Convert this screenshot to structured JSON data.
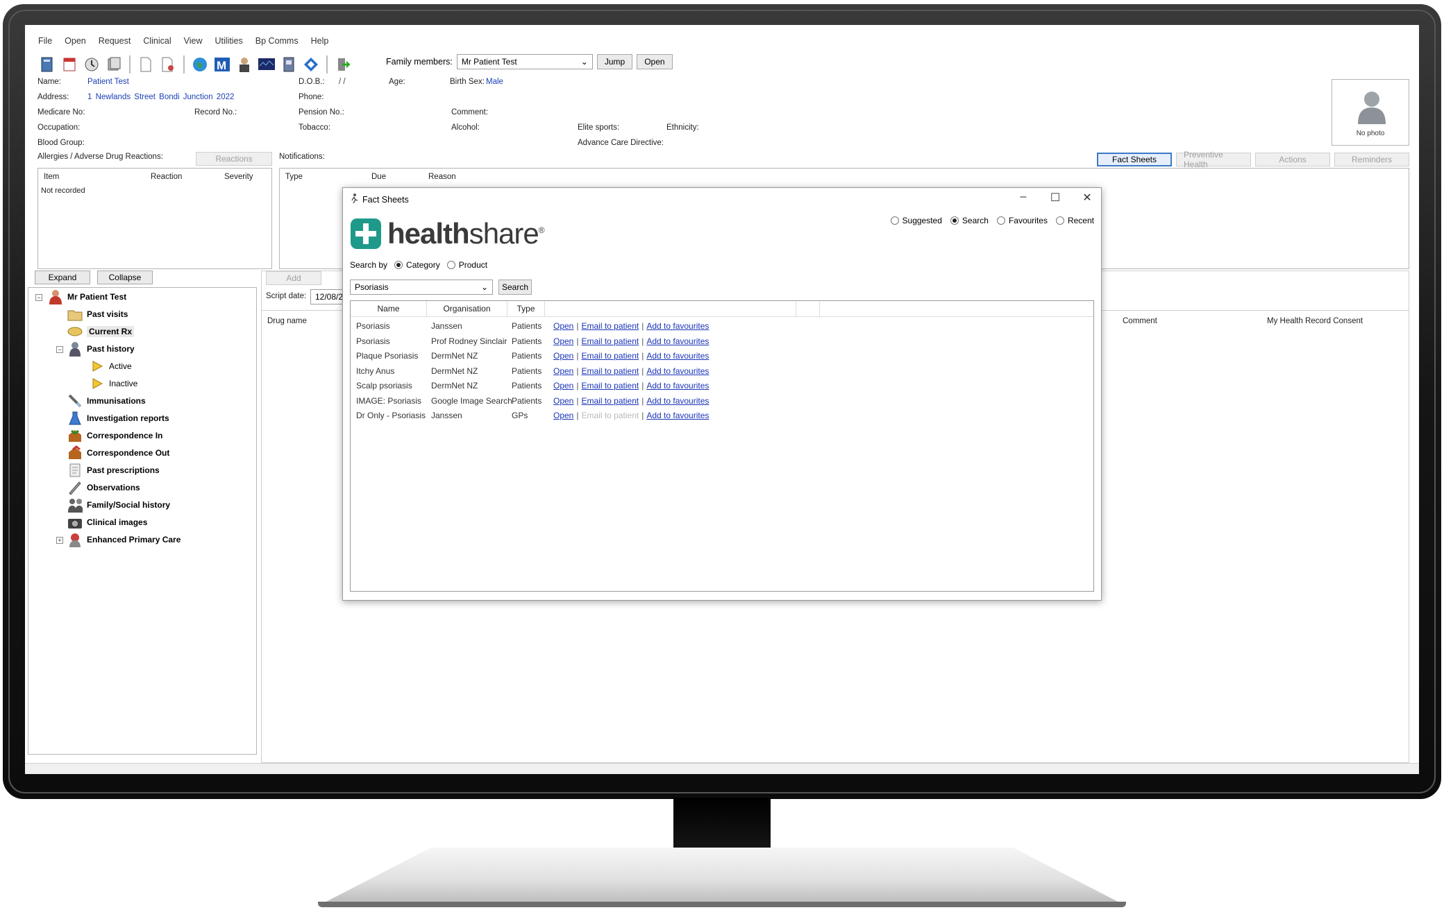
{
  "menu": [
    "File",
    "Open",
    "Request",
    "Clinical",
    "View",
    "Utilities",
    "Bp Comms",
    "Help"
  ],
  "family": {
    "label": "Family members:",
    "selected": "Mr Patient Test",
    "jump": "Jump",
    "open": "Open"
  },
  "patient": {
    "name_label": "Name:",
    "name": "Patient Test",
    "address_label": "Address:",
    "address": "1 Newlands Street  Bondi Junction  2022",
    "medicare_label": "Medicare No:",
    "record_label": "Record No.:",
    "occupation_label": "Occupation:",
    "blood_label": "Blood Group:",
    "dob_label": "D.O.B.:",
    "dob": "/  /",
    "phone_label": "Phone:",
    "pension_label": "Pension No.:",
    "tobacco_label": "Tobacco:",
    "age_label": "Age:",
    "birthsex_label": "Birth Sex:",
    "birthsex": "Male",
    "comment_label": "Comment:",
    "alcohol_label": "Alcohol:",
    "elite_label": "Elite sports:",
    "ethnicity_label": "Ethnicity:",
    "acd_label": "Advance Care Directive:",
    "photo_caption": "No photo"
  },
  "allergies": {
    "label": "Allergies / Adverse Drug Reactions:",
    "reactions_btn": "Reactions",
    "cols": [
      "Item",
      "Reaction",
      "Severity"
    ],
    "empty": "Not recorded"
  },
  "notifications": {
    "label": "Notifications:",
    "cols": [
      "Type",
      "Due",
      "Reason"
    ]
  },
  "side_buttons": [
    "Fact Sheets",
    "Preventive Health",
    "Actions",
    "Reminders"
  ],
  "tree_buttons": {
    "expand": "Expand",
    "collapse": "Collapse"
  },
  "rx": {
    "add": "Add",
    "script_date_label": "Script date:",
    "script_date": "12/08/2",
    "drug_col": "Drug name",
    "comment_col": "Comment",
    "mhr_col": "My Health Record Consent"
  },
  "tree": {
    "root": "Mr Patient Test",
    "items": [
      "Past visits",
      "Current Rx",
      "Past history",
      "Active",
      "Inactive",
      "Immunisations",
      "Investigation reports",
      "Correspondence In",
      "Correspondence Out",
      "Past prescriptions",
      "Observations",
      "Family/Social history",
      "Clinical images",
      "Enhanced Primary Care"
    ]
  },
  "dialog": {
    "title": "Fact Sheets",
    "logo_bold": "health",
    "logo_rest": "share",
    "logo_reg": "®",
    "modes": [
      "Suggested",
      "Search",
      "Favourites",
      "Recent"
    ],
    "mode_selected": "Search",
    "search_by_label": "Search by",
    "search_by": [
      "Category",
      "Product"
    ],
    "search_value": "Psoriasis",
    "search_btn": "Search",
    "cols": [
      "Name",
      "Organisation",
      "Type"
    ],
    "actions": {
      "open": "Open",
      "email": "Email to patient",
      "fav": "Add to favourites"
    },
    "rows": [
      {
        "name": "Psoriasis",
        "org": "Janssen",
        "type": "Patients"
      },
      {
        "name": "Psoriasis",
        "org": "Prof Rodney Sinclair",
        "type": "Patients"
      },
      {
        "name": "Plaque Psoriasis",
        "org": "DermNet NZ",
        "type": "Patients"
      },
      {
        "name": "Itchy Anus",
        "org": "DermNet NZ",
        "type": "Patients"
      },
      {
        "name": "Scalp psoriasis",
        "org": "DermNet NZ",
        "type": "Patients"
      },
      {
        "name": "IMAGE: Psoriasis",
        "org": "Google Image Search",
        "type": "Patients"
      },
      {
        "name": "Dr Only - Psoriasis",
        "org": "Janssen",
        "type": "GPs"
      }
    ]
  }
}
